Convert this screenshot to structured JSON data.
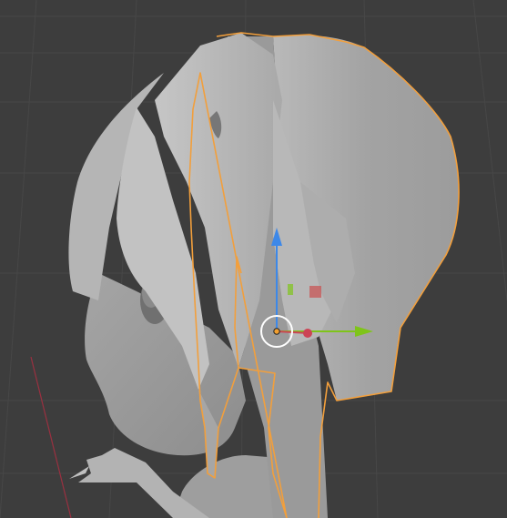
{
  "app": {
    "name": "3D Viewport",
    "view": "perspective"
  },
  "scene": {
    "background_color": "#3d3d3d",
    "grid_line_color": "#474747",
    "model_color": "#a8a8a8",
    "selection_outline_color": "#f29f3c",
    "selected_object": "hair-mesh"
  },
  "gizmo": {
    "type": "move-transform",
    "axis_x_color": "#7fc41a",
    "axis_y_color": "#cc4455",
    "axis_z_color": "#3d88e8",
    "center_ring_color": "#ffffff",
    "origin_color": "#f2a030"
  },
  "axes": {
    "x_axis_line_color": "#9a3040"
  }
}
